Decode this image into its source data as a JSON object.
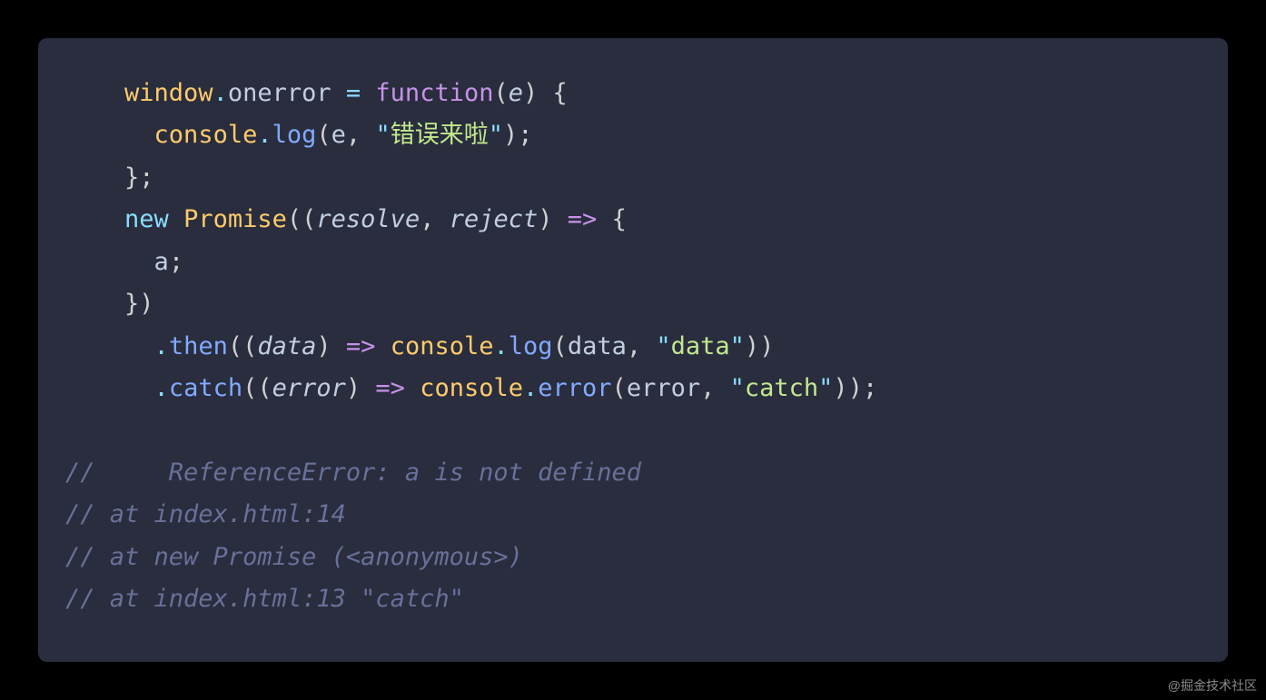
{
  "watermark": "@掘金技术社区",
  "code": {
    "l1": {
      "window": "window",
      "dot1": ".",
      "onerror": "onerror",
      "eq": " = ",
      "function": "function",
      "lp": "(",
      "e": "e",
      "rp": ")",
      "lb": " {"
    },
    "l2": {
      "indent": "      ",
      "console": "console",
      "dot": ".",
      "log": "log",
      "lp": "(",
      "e": "e",
      "comma": ", ",
      "q1": "\"",
      "str": "错误来啦",
      "q2": "\"",
      "rp": ")",
      "semi": ";"
    },
    "l3": {
      "indent": "    ",
      "text": "};"
    },
    "l4": {
      "indent": "    ",
      "new": "new",
      "sp": " ",
      "promise": "Promise",
      "lp": "(",
      "lp2": "(",
      "resolve": "resolve",
      "comma": ", ",
      "reject": "reject",
      "rp2": ")",
      "arrow": " => ",
      "lb": "{"
    },
    "l5": {
      "indent": "      ",
      "a": "a",
      "semi": ";"
    },
    "l6": {
      "indent": "    ",
      "text": "})"
    },
    "l7": {
      "indent": "      ",
      "dot": ".",
      "then": "then",
      "lp": "(",
      "lp2": "(",
      "data": "data",
      "rp2": ")",
      "arrow": " => ",
      "console": "console",
      "dot2": ".",
      "log": "log",
      "lp3": "(",
      "data2": "data",
      "comma": ", ",
      "q1": "\"",
      "str": "data",
      "q2": "\"",
      "rp3": ")",
      "rp": ")"
    },
    "l8": {
      "indent": "      ",
      "dot": ".",
      "catch": "catch",
      "lp": "(",
      "lp2": "(",
      "error": "error",
      "rp2": ")",
      "arrow": " => ",
      "console": "console",
      "dot2": ".",
      "errorfn": "error",
      "lp3": "(",
      "error2": "error",
      "comma": ", ",
      "q1": "\"",
      "str": "catch",
      "q2": "\"",
      "rp3": ")",
      "rp": ")",
      "semi": ";"
    },
    "c1": "//     ReferenceError: a is not defined",
    "c2": "// at index.html:14",
    "c3": "// at new Promise (<anonymous>)",
    "c4": "// at index.html:13 \"catch\""
  }
}
